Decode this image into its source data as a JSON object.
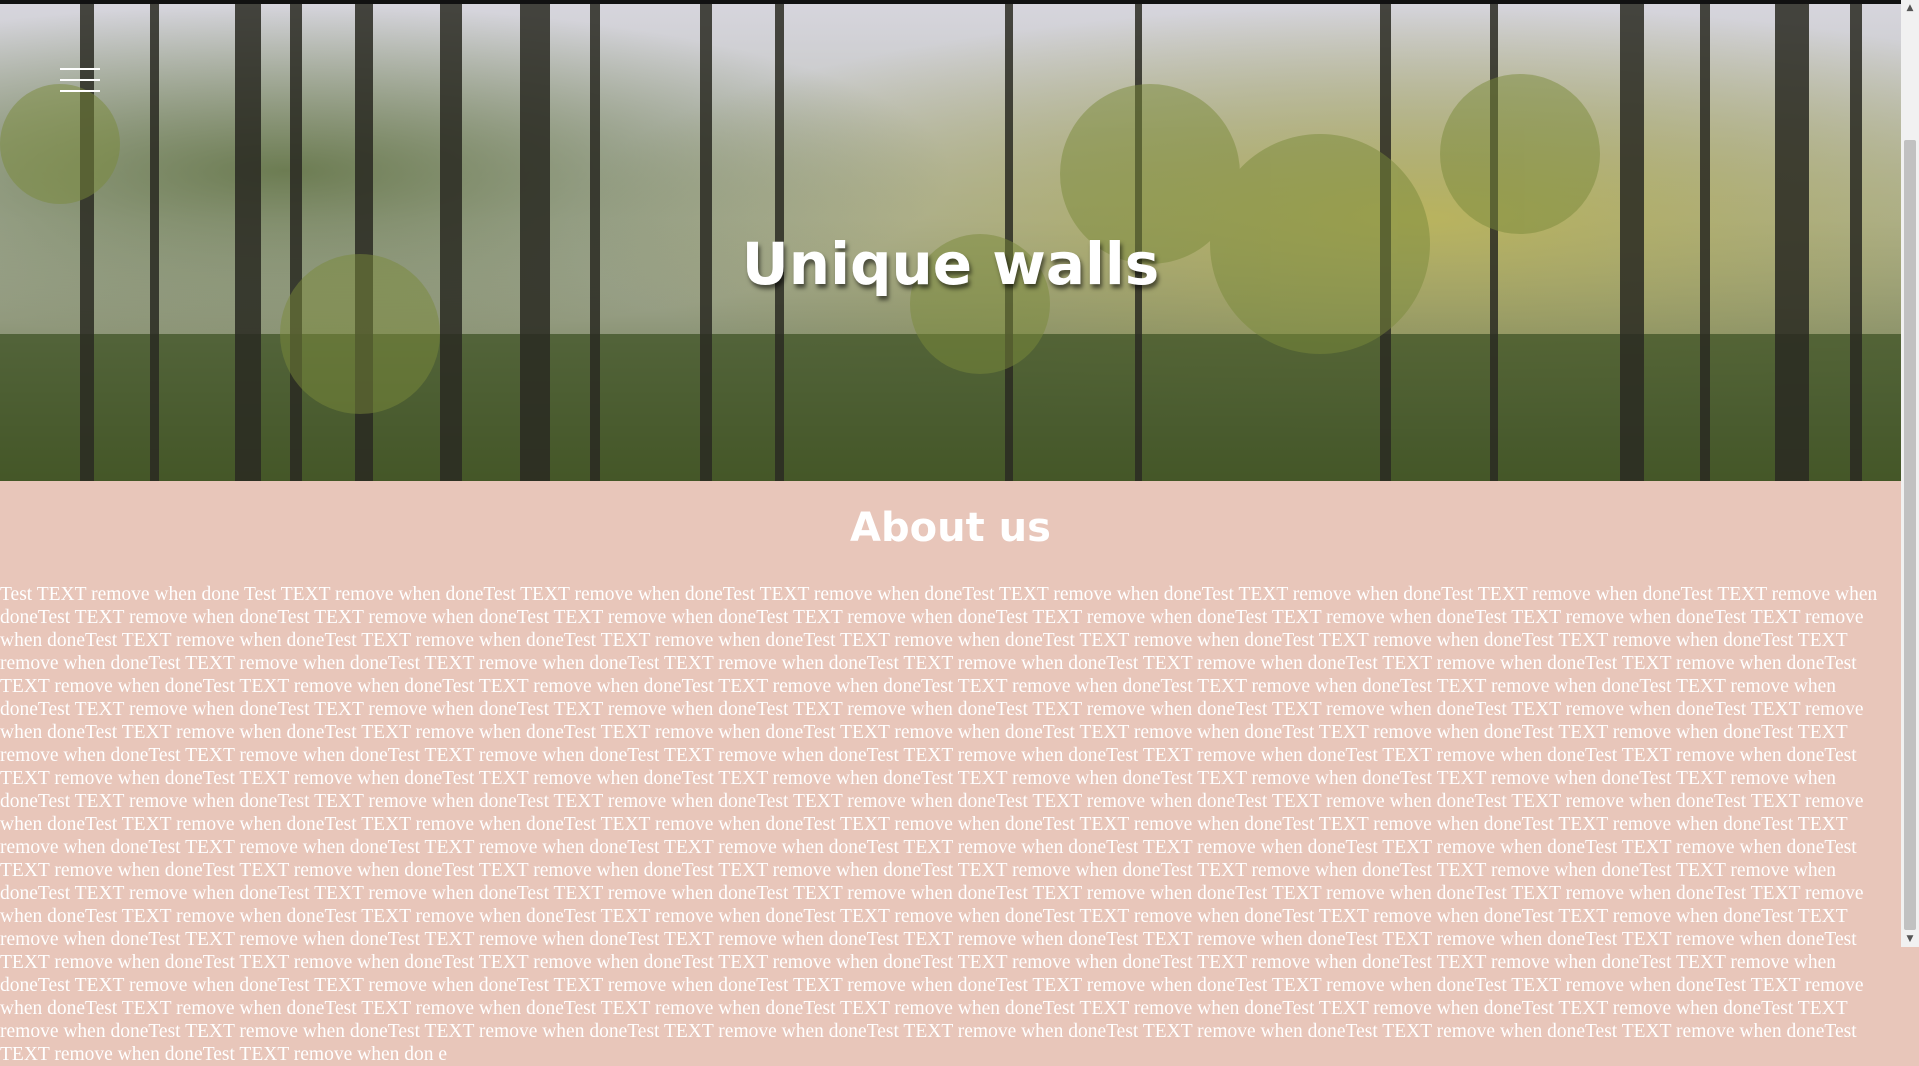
{
  "hero": {
    "title": "Unique walls",
    "menu_icon": "hamburger-menu-icon"
  },
  "about": {
    "heading": "About us",
    "body": "Test TEXT remove when done Test TEXT remove when doneTest TEXT remove when doneTest TEXT remove when doneTest TEXT remove when doneTest TEXT remove when doneTest TEXT remove when doneTest TEXT remove when doneTest TEXT remove when doneTest TEXT remove when doneTest TEXT remove when doneTest TEXT remove when doneTest TEXT remove when doneTest TEXT remove when doneTest TEXT remove when doneTest TEXT remove when doneTest TEXT remove when doneTest TEXT remove when doneTest TEXT remove when doneTest TEXT remove when doneTest TEXT remove when doneTest TEXT remove when doneTest TEXT remove when doneTest TEXT remove when doneTest TEXT remove when doneTest TEXT remove when doneTest TEXT remove when doneTest TEXT remove when doneTest TEXT remove when doneTest TEXT remove when doneTest TEXT remove when doneTest TEXT remove when doneTest TEXT remove when doneTest TEXT remove when doneTest TEXT remove when doneTest TEXT remove when doneTest TEXT remove when doneTest TEXT remove when doneTest TEXT remove when doneTest TEXT remove when doneTest TEXT remove when doneTest TEXT remove when doneTest TEXT remove when doneTest TEXT remove when doneTest TEXT remove when doneTest TEXT remove when doneTest TEXT remove when doneTest TEXT remove when doneTest TEXT remove when doneTest TEXT remove when doneTest TEXT remove when doneTest TEXT remove when doneTest TEXT remove when doneTest TEXT remove when doneTest TEXT remove when doneTest TEXT remove when doneTest TEXT remove when doneTest TEXT remove when doneTest TEXT remove when doneTest TEXT remove when doneTest TEXT remove when doneTest TEXT remove when doneTest TEXT remove when doneTest TEXT remove when doneTest TEXT remove when doneTest TEXT remove when doneTest TEXT remove when doneTest TEXT remove when doneTest TEXT remove when doneTest TEXT remove when doneTest TEXT remove when doneTest TEXT remove when doneTest TEXT remove when doneTest TEXT remove when doneTest TEXT remove when doneTest TEXT remove when doneTest TEXT remove when doneTest TEXT remove when doneTest TEXT remove when doneTest TEXT remove when doneTest TEXT remove when doneTest TEXT remove when doneTest TEXT remove when doneTest TEXT remove when doneTest TEXT remove when doneTest TEXT remove when doneTest TEXT remove when doneTest TEXT remove when doneTest TEXT remove when doneTest TEXT remove when doneTest TEXT remove when doneTest TEXT remove when doneTest TEXT remove when doneTest TEXT remove when doneTest TEXT remove when doneTest TEXT remove when doneTest TEXT remove when doneTest TEXT remove when doneTest TEXT remove when doneTest TEXT remove when doneTest TEXT remove when doneTest TEXT remove when doneTest TEXT remove when doneTest TEXT remove when doneTest TEXT remove when doneTest TEXT remove when doneTest TEXT remove when doneTest TEXT remove when doneTest TEXT remove when doneTest TEXT remove when doneTest TEXT remove when doneTest TEXT remove when doneTest TEXT remove when doneTest TEXT remove when doneTest TEXT remove when doneTest TEXT remove when doneTest TEXT remove when doneTest TEXT remove when doneTest TEXT remove when doneTest TEXT remove when doneTest TEXT remove when doneTest TEXT remove when doneTest TEXT remove when doneTest TEXT remove when doneTest TEXT remove when doneTest TEXT remove when doneTest TEXT remove when doneTest TEXT remove when doneTest TEXT remove when doneTest TEXT remove when doneTest TEXT remove when doneTest TEXT remove when doneTest TEXT remove when doneTest TEXT remove when doneTest TEXT remove when doneTest TEXT remove when doneTest TEXT remove when doneTest TEXT remove when doneTest TEXT remove when doneTest TEXT remove when doneTest TEXT remove when doneTest TEXT remove when doneTest TEXT remove when doneTest TEXT remove when doneTest TEXT remove when doneTest TEXT remove when doneTest TEXT remove when doneTest TEXT remove when doneTest TEXT remove when doneTest TEXT remove when doneTest TEXT remove when doneTest TEXT remove when doneTest TEXT remove when doneTest TEXT remove when doneTest TEXT remove when doneTest TEXT remove when doneTest TEXT remove when don e"
  },
  "colors": {
    "about_background": "#e8c6ba",
    "text": "#ffffff"
  }
}
